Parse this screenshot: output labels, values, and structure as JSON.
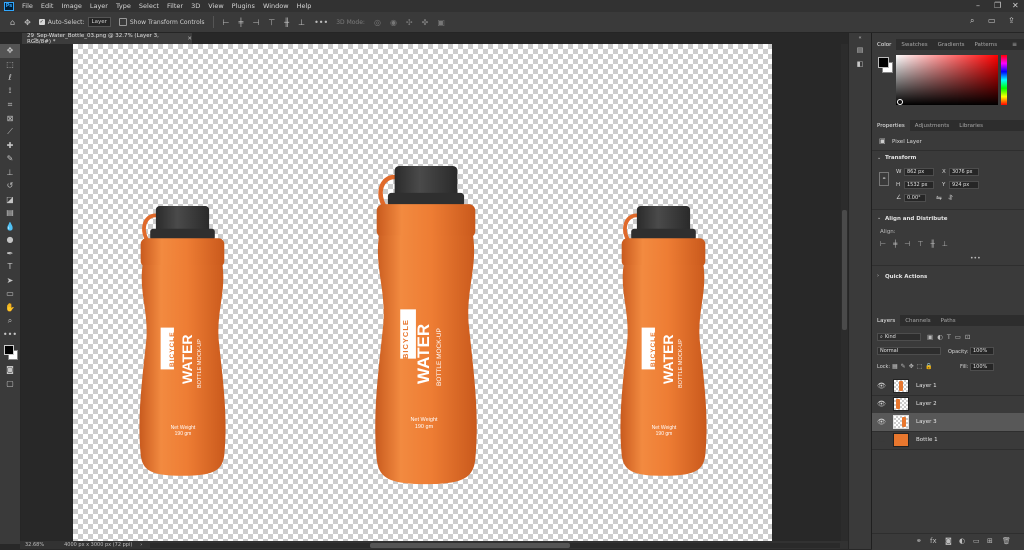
{
  "menubar": {
    "app_icon": "Ps",
    "items": [
      "File",
      "Edit",
      "Image",
      "Layer",
      "Type",
      "Select",
      "Filter",
      "3D",
      "View",
      "Plugins",
      "Window",
      "Help"
    ]
  },
  "options": {
    "auto_select_label": "Auto-Select:",
    "auto_select_value": "Layer",
    "show_transform_label": "Show Transform Controls",
    "mode_label": "3D Mode:"
  },
  "document": {
    "tab_title": "29_Sep-Water_Bottle_03.png @ 32.7% (Layer 3, RGB/8#) *"
  },
  "status": {
    "zoom": "32.68%",
    "doc_size": "4000 px x 3000 px (72 ppi)"
  },
  "bottles": {
    "brand_line1": "BICYCLE",
    "brand_line2": "WATER",
    "tagline": "BOTTLE MOCK-UP",
    "net_weight": "Net Weight",
    "grams": "190 gm"
  },
  "color_panel": {
    "tabs": [
      "Color",
      "Swatches",
      "Gradients",
      "Patterns"
    ],
    "foreground": "#000000",
    "background": "#ffffff",
    "hue": "#ff0000"
  },
  "properties": {
    "tabs": [
      "Properties",
      "Adjustments",
      "Libraries"
    ],
    "layer_type": "Pixel Layer",
    "transform_header": "Transform",
    "w_label": "W",
    "w_value": "862 px",
    "h_label": "H",
    "h_value": "1532 px",
    "x_label": "X",
    "x_value": "3076 px",
    "y_label": "Y",
    "y_value": "924 px",
    "angle_value": "0.00°",
    "align_header": "Align and Distribute",
    "align_label": "Align:",
    "quick_actions_header": "Quick Actions"
  },
  "layers_panel": {
    "tabs": [
      "Layers",
      "Channels",
      "Paths"
    ],
    "filter_kind": "Kind",
    "blend_mode": "Normal",
    "opacity_label": "Opacity:",
    "opacity_value": "100%",
    "lock_label": "Lock:",
    "fill_label": "Fill:",
    "fill_value": "100%",
    "layers": [
      {
        "name": "Layer 1",
        "selected": false
      },
      {
        "name": "Layer 2",
        "selected": false
      },
      {
        "name": "Layer 3",
        "selected": true
      },
      {
        "name": "Bottle 1",
        "selected": false
      }
    ]
  },
  "colors": {
    "bottle_orange": "#ec7a32",
    "cap_gray": "#3b3b3b",
    "panel_bg": "#3a3a3a"
  }
}
